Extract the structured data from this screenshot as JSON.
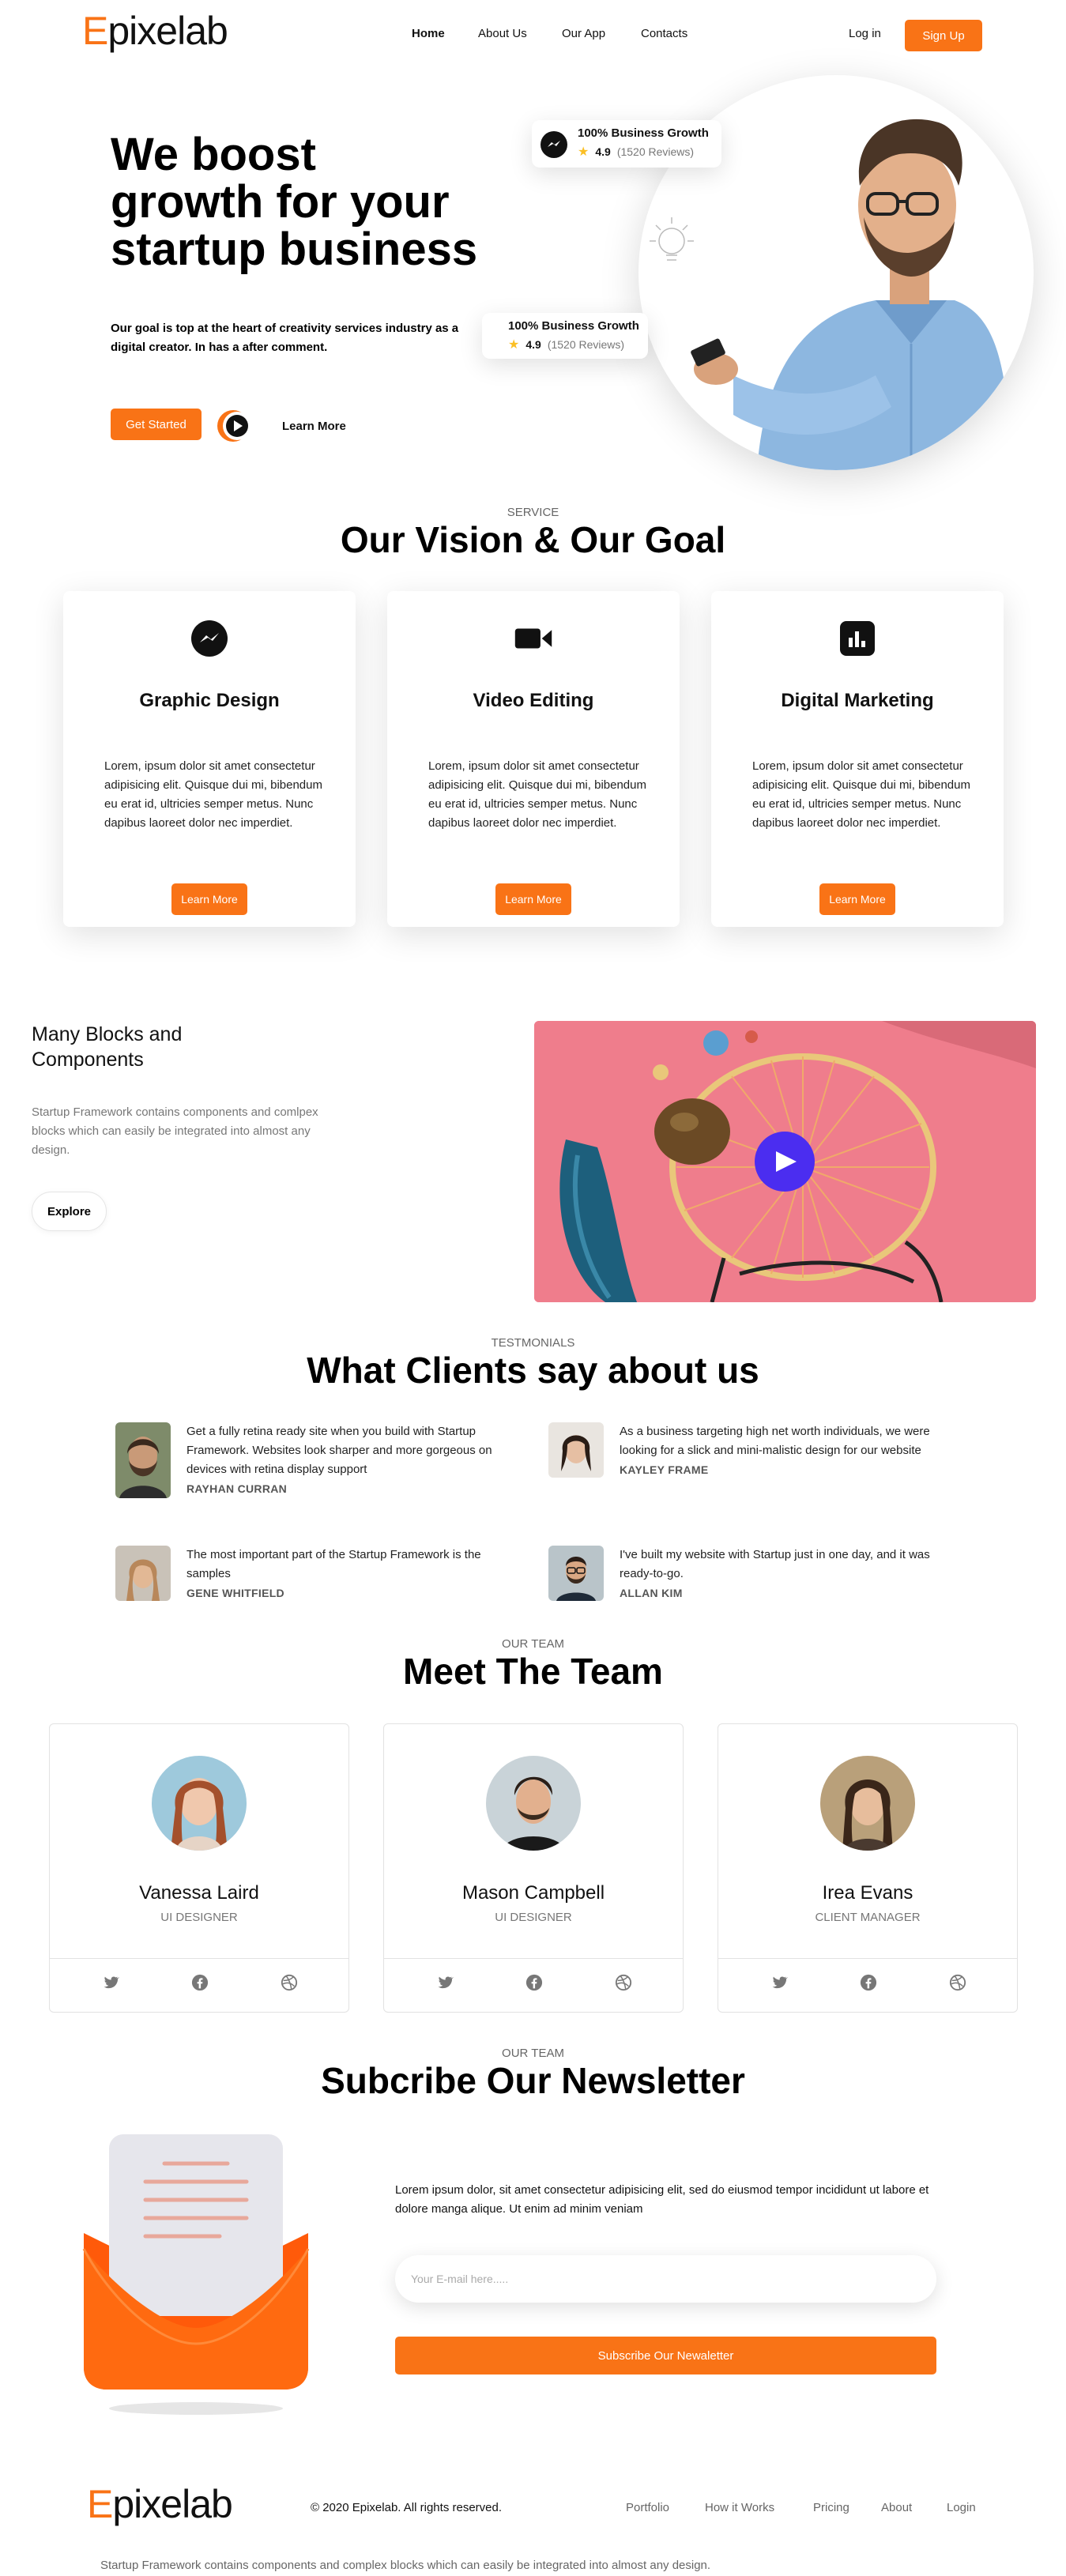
{
  "brand": {
    "logo_prefix": "E",
    "logo_rest": "pixelab",
    "accent": "#f97316"
  },
  "nav": {
    "links": [
      "Home",
      "About Us",
      "Our App",
      "Contacts"
    ],
    "login": "Log in",
    "signup": "Sign Up"
  },
  "hero": {
    "title_line1": "We boost",
    "title_line2": "growth for your",
    "title_line3": "startup business",
    "subtitle": "Our goal is top at the heart of creativity services industry as a digital creator. In has a after comment.",
    "get_started": "Get Started",
    "learn_more": "Learn More",
    "rating_cards": [
      {
        "title": "100% Business Growth",
        "score": "4.9",
        "reviews": "(1520 Reviews)"
      },
      {
        "title": "100% Business Growth",
        "score": "4.9",
        "reviews": "(1520 Reviews)"
      }
    ]
  },
  "services": {
    "eyebrow": "SERVICE",
    "title": "Our Vision & Our Goal",
    "cards": [
      {
        "icon": "messenger-icon",
        "title": "Graphic Design",
        "desc": "Lorem, ipsum dolor sit amet consectetur adipisicing elit. Quisque dui mi, bibendum eu erat id, ultricies semper metus. Nunc dapibus laoreet dolor nec imperdiet.",
        "button": "Learn More"
      },
      {
        "icon": "video-camera-icon",
        "title": "Video Editing",
        "desc": "Lorem, ipsum dolor sit amet consectetur adipisicing elit. Quisque dui mi, bibendum eu erat id, ultricies semper metus. Nunc dapibus laoreet dolor nec imperdiet.",
        "button": "Learn More"
      },
      {
        "icon": "bar-chart-icon",
        "title": "Digital Marketing",
        "desc": "Lorem, ipsum dolor sit amet consectetur adipisicing elit. Quisque dui mi, bibendum eu erat id, ultricies semper metus. Nunc dapibus laoreet dolor nec imperdiet.",
        "button": "Learn More"
      }
    ]
  },
  "blocks": {
    "title": "Many Blocks and Components",
    "desc": "Startup Framework contains components and comlpex blocks which can easily be integrated into almost any design.",
    "explore": "Explore"
  },
  "testimonials": {
    "eyebrow": "TESTMONIALS",
    "title": "What Clients say about us",
    "items": [
      {
        "text": "Get a fully retina ready site when you build with Startup Framework. Websites look sharper and more gorgeous on devices with retina display support",
        "name": "RAYHAN CURRAN"
      },
      {
        "text": "As a business targeting high net worth individuals, we were looking for a slick and mini-malistic design for our website",
        "name": "KAYLEY FRAME"
      },
      {
        "text": "The most important part of the Startup Framework is the samples",
        "name": "GENE WHITFIELD"
      },
      {
        "text": "I've built my website with Startup just in one day, and it was ready-to-go.",
        "name": "ALLAN KIM"
      }
    ]
  },
  "team": {
    "eyebrow": "OUR TEAM",
    "title": "Meet The Team",
    "members": [
      {
        "name": "Vanessa Laird",
        "role": "UI DESIGNER"
      },
      {
        "name": "Mason Campbell",
        "role": "UI DESIGNER"
      },
      {
        "name": "Irea Evans",
        "role": "CLIENT MANAGER"
      }
    ]
  },
  "newsletter": {
    "eyebrow": "OUR TEAM",
    "title": "Subcribe Our Newsletter",
    "desc": "Lorem ipsum dolor, sit amet consectetur adipisicing elit, sed do eiusmod tempor incididunt ut labore et dolore manga alique. Ut enim ad minim veniam",
    "placeholder": "Your E-mail here.....",
    "button": "Subscribe Our Newaletter"
  },
  "footer": {
    "copyright": "© 2020 Epixelab. All rights reserved.",
    "links": [
      "Portfolio",
      "How it Works",
      "Pricing",
      "About",
      "Login"
    ],
    "note": "Startup Framework contains components and complex blocks which can easily be integrated into almost any design."
  }
}
